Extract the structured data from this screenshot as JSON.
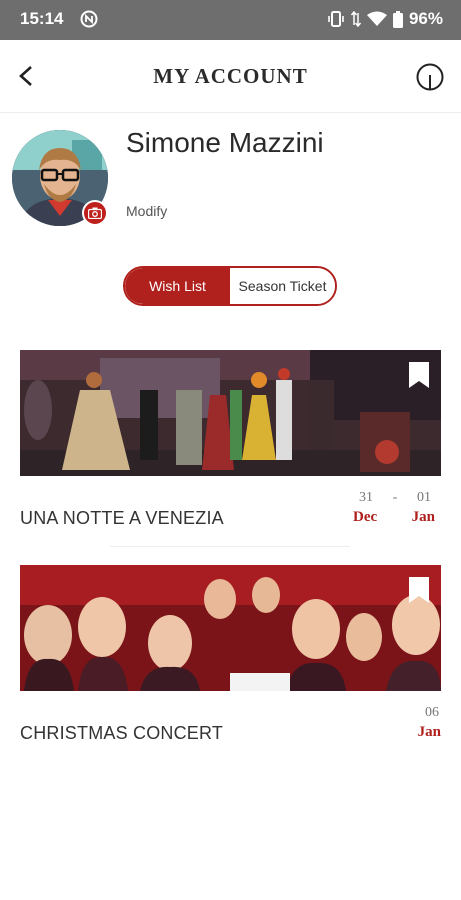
{
  "status_bar": {
    "time": "15:14",
    "battery": "96%"
  },
  "header": {
    "title": "MY ACCOUNT"
  },
  "profile": {
    "name": "Simone Mazzini",
    "modify_label": "Modify"
  },
  "tabs": {
    "wish_list": "Wish List",
    "season_ticket": "Season Ticket",
    "active": "wish_list"
  },
  "events": [
    {
      "title": "UNA NOTTE A VENEZIA",
      "day_start": "31",
      "day_separator": "-",
      "day_end": "01",
      "month_start": "Dec",
      "month_end": "Jan"
    },
    {
      "title": "CHRISTMAS CONCERT",
      "day": "06",
      "month": "Jan"
    }
  ],
  "colors": {
    "accent": "#b0211d",
    "status_bar": "#6e6e6e"
  }
}
